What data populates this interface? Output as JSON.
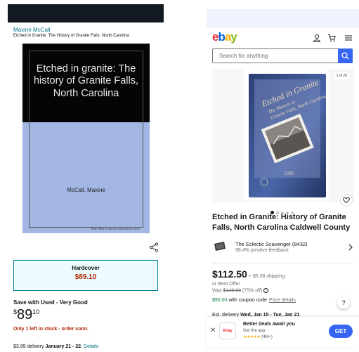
{
  "amazon": {
    "author": "Maxine McCall",
    "subtitle": "Etched in Granite: The History of Granite Falls, North Carolina",
    "cover": {
      "title": "Etched in granite: The history of Granite Falls, North Carolina",
      "author": "McCall, Maxine",
      "note": "Note: This is not the actual book cover"
    },
    "format": {
      "label": "Hardcover",
      "price": "$89.10"
    },
    "used_label": "Save with Used - Very Good",
    "price": {
      "symbol": "$",
      "whole": "89",
      "fraction": "10"
    },
    "stock": "Only 1 left in stock - order soon.",
    "delivery": {
      "prefix": "$3.99 delivery ",
      "dates": "January 21 - 22",
      "sep": ". ",
      "link": "Details"
    }
  },
  "ebay": {
    "logo": {
      "e": "e",
      "b": "b",
      "a": "a",
      "y": "y"
    },
    "search": {
      "placeholder": "Search for anything"
    },
    "gallery": {
      "counter": "1 of 20"
    },
    "title": "Etched in Granite: History of Granite Falls, North Carolina Caldwell County",
    "seller": {
      "name": "The Eclectic Scavenger (8432)",
      "feedback": "98.4% positive feedback"
    },
    "price": "$112.50",
    "shipping": "+ $5.38 shipping",
    "best_offer": "or Best Offer",
    "was": {
      "prefix": "Was ",
      "old": "$449.99",
      "discount": " (75% off) "
    },
    "coupon": {
      "amount": "$90.00",
      "text": " with coupon code",
      "link": "Price details"
    },
    "delivery": {
      "prefix": "Est. delivery ",
      "dates": "Wed, Jan 15 - Tue, Jan 21"
    },
    "banner": {
      "logo": "ebay",
      "title": "Better deals await you",
      "subtitle": "Get the app",
      "rating_stars": "★★★★★",
      "rating_count": "(4M+)",
      "cta": "GET"
    },
    "help": "?",
    "colors": {
      "accent": "#3665f3",
      "coupon": "#05823f"
    }
  }
}
